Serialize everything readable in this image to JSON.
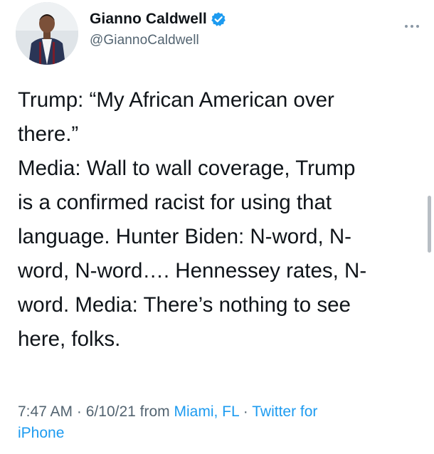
{
  "tweet": {
    "author": {
      "display_name": "Gianno Caldwell",
      "handle": "@GiannoCaldwell",
      "verified": true,
      "avatar_icon": "profile-photo-icon"
    },
    "text_lines": [
      "Trump: “My African American over",
      "there.”",
      "Media: Wall to wall coverage, Trump",
      "is a confirmed racist for using that",
      "language. Hunter Biden: N-word, N-",
      "word, N-word…. Hennessey rates, N-",
      "word. Media: There’s nothing to see",
      "here, folks."
    ],
    "meta": {
      "time": "7:47 AM",
      "separator": "·",
      "date": "6/10/21",
      "from_label": "from",
      "location": "Miami, FL",
      "source": "Twitter for",
      "source_line2": "iPhone"
    },
    "more_icon": "more-horizontal-icon"
  },
  "colors": {
    "text": "#0f1419",
    "secondary": "#536471",
    "link": "#1d9bf0",
    "verified_badge": "#1d9bf0"
  }
}
